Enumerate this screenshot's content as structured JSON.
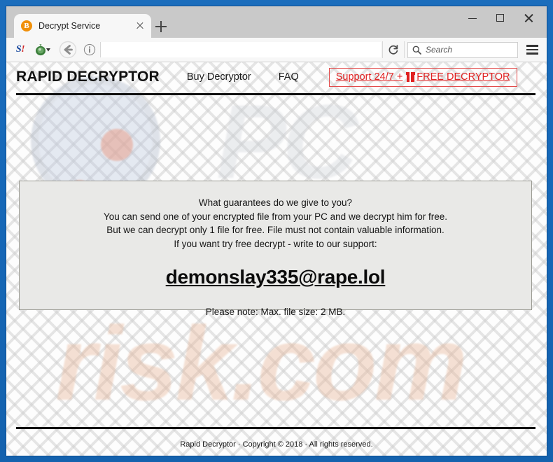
{
  "window": {
    "tab": {
      "favicon": "bitcoin-b-icon",
      "favicon_glyph": "Ƀ",
      "title": "Decrypt Service",
      "close_label": "×"
    },
    "new_tab_label": "+",
    "controls": {
      "minimize": "minimize-icon",
      "maximize": "maximize-icon",
      "close": "close-icon"
    }
  },
  "toolbar": {
    "extension_s_text": "S",
    "extension_s_bang": "!",
    "onion_icon": "onion-icon",
    "back_icon": "back-arrow-icon",
    "info_icon": "page-info-icon",
    "url_value": "",
    "url_placeholder": "",
    "reload_icon": "reload-icon",
    "search_icon": "search-icon",
    "search_value": "",
    "search_placeholder": "Search",
    "menu_icon": "hamburger-menu-icon"
  },
  "site": {
    "brand": "RAPID DECRYPTOR",
    "nav": [
      {
        "label": "Buy Decryptor"
      },
      {
        "label": "FAQ"
      }
    ],
    "support_button": {
      "prefix": "Support 24/7 + ",
      "icon": "gift-icon",
      "suffix": "FREE DECRYPTOR",
      "color": "#e02020"
    },
    "message": {
      "lines": [
        "What guarantees do we give to you?",
        "You can send one of your encrypted file from your PC and we decrypt him for free.",
        "But we can decrypt only 1 file for free. File must not contain valuable information.",
        "If you want try free decrypt - write to our support:"
      ],
      "email": "demonslay335@rape.lol",
      "note": "Please note: Max. file size: 2 MB."
    },
    "footer": "Rapid Decryptor · Copyright © 2018 · All rights reserved."
  },
  "watermark": {
    "top_text": "PC",
    "bottom_text": "risk.com",
    "glass": "magnifying-glass-logo"
  }
}
